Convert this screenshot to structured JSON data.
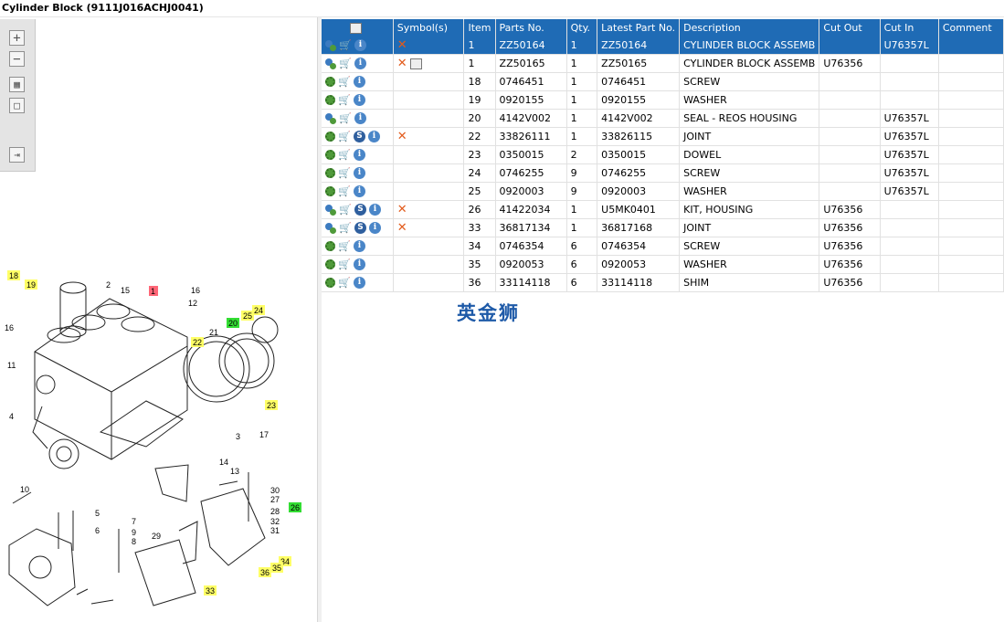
{
  "window": {
    "title": "Cylinder Block (9111J016ACHJ0041)"
  },
  "toolbar": {
    "zoom_in": "+",
    "zoom_out": "−",
    "fit": "▦",
    "box": "□",
    "export": "⇥"
  },
  "grid": {
    "columns": [
      "",
      "Symbol(s)",
      "Item",
      "Parts No.",
      "Qty.",
      "Latest Part No.",
      "Description",
      "Cut Out",
      "Cut In",
      "Comment"
    ],
    "rows": [
      {
        "item": "1",
        "part": "ZZ50164",
        "qty": "1",
        "latest": "ZZ50164",
        "desc": "CYLINDER BLOCK ASSEMB",
        "cut_out": "",
        "cut_in": "U76357L",
        "comment": ""
      },
      {
        "item": "1",
        "part": "ZZ50165",
        "qty": "1",
        "latest": "ZZ50165",
        "desc": "CYLINDER BLOCK ASSEMB",
        "cut_out": "U76356",
        "cut_in": "",
        "comment": ""
      },
      {
        "item": "18",
        "part": "0746451",
        "qty": "1",
        "latest": "0746451",
        "desc": "SCREW",
        "cut_out": "",
        "cut_in": "",
        "comment": ""
      },
      {
        "item": "19",
        "part": "0920155",
        "qty": "1",
        "latest": "0920155",
        "desc": "WASHER",
        "cut_out": "",
        "cut_in": "",
        "comment": ""
      },
      {
        "item": "20",
        "part": "4142V002",
        "qty": "1",
        "latest": "4142V002",
        "desc": "SEAL - REOS HOUSING",
        "cut_out": "",
        "cut_in": "U76357L",
        "comment": ""
      },
      {
        "item": "22",
        "part": "33826111",
        "qty": "1",
        "latest": "33826115",
        "desc": "JOINT",
        "cut_out": "",
        "cut_in": "U76357L",
        "comment": ""
      },
      {
        "item": "23",
        "part": "0350015",
        "qty": "2",
        "latest": "0350015",
        "desc": "DOWEL",
        "cut_out": "",
        "cut_in": "U76357L",
        "comment": ""
      },
      {
        "item": "24",
        "part": "0746255",
        "qty": "9",
        "latest": "0746255",
        "desc": "SCREW",
        "cut_out": "",
        "cut_in": "U76357L",
        "comment": ""
      },
      {
        "item": "25",
        "part": "0920003",
        "qty": "9",
        "latest": "0920003",
        "desc": "WASHER",
        "cut_out": "",
        "cut_in": "U76357L",
        "comment": ""
      },
      {
        "item": "26",
        "part": "41422034",
        "qty": "1",
        "latest": "U5MK0401",
        "desc": "KIT, HOUSING",
        "cut_out": "U76356",
        "cut_in": "",
        "comment": ""
      },
      {
        "item": "33",
        "part": "36817134",
        "qty": "1",
        "latest": "36817168",
        "desc": "JOINT",
        "cut_out": "U76356",
        "cut_in": "",
        "comment": ""
      },
      {
        "item": "34",
        "part": "0746354",
        "qty": "6",
        "latest": "0746354",
        "desc": "SCREW",
        "cut_out": "U76356",
        "cut_in": "",
        "comment": ""
      },
      {
        "item": "35",
        "part": "0920053",
        "qty": "6",
        "latest": "0920053",
        "desc": "WASHER",
        "cut_out": "U76356",
        "cut_in": "",
        "comment": ""
      },
      {
        "item": "36",
        "part": "33114118",
        "qty": "6",
        "latest": "33114118",
        "desc": "SHIM",
        "cut_out": "U76356",
        "cut_in": "",
        "comment": ""
      }
    ]
  },
  "icons": {
    "cart": "🛒",
    "info": "i",
    "service": "S",
    "remove": "✕"
  },
  "watermark": "英金狮",
  "diagram": {
    "callouts": [
      "18",
      "19",
      "16",
      "11",
      "4",
      "10",
      "2",
      "15",
      "1",
      "16",
      "12",
      "22",
      "21",
      "20",
      "25",
      "24",
      "23",
      "3",
      "17",
      "14",
      "13",
      "5",
      "6",
      "7",
      "9",
      "8",
      "29",
      "30",
      "27",
      "28",
      "32",
      "31",
      "34",
      "35",
      "36",
      "26",
      "33"
    ],
    "highlight_yellow": "#ffff66",
    "highlight_green": "#33dd33",
    "highlight_red": "#ff6677"
  }
}
